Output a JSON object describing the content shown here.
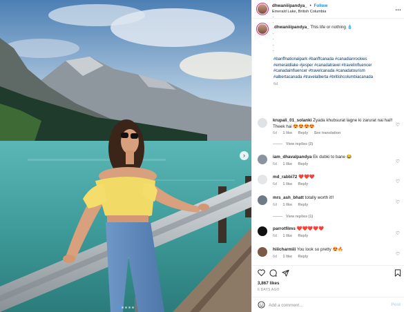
{
  "header": {
    "username": "dhwaniiipandya_",
    "separator": "•",
    "follow_label": "Follow",
    "location": "Emerald Lake, British Columbia",
    "more": "…"
  },
  "caption": {
    "username": "dhwaniiipandya_",
    "text": "This life or nothing 💧",
    "dot_lines": [
      ".",
      ".",
      ".",
      ".",
      ".",
      ".",
      ".",
      "."
    ],
    "hashtags": "#banffnationalpark #banffcanada #canadianrockies #emeraldlake #jesper #canadatravel #travelinfluencer #canadainfluencer #travelcanada #canadatourism #albertacanada #travelalberta #britishcolumbiacanada",
    "time": "6d"
  },
  "comments": [
    {
      "username": "krupali_01_solanki",
      "text": "Zyada khubsurat lagne ki zarurat nai hai!! Theek hai 😍😍😍😍",
      "time": "6d",
      "likes": "1 like",
      "reply": "Reply",
      "extra": "See translation",
      "replies_label": "View replies (2)"
    },
    {
      "username": "iam_dhavalpandya",
      "text": "Ek dubki to bane 😂",
      "time": "6d",
      "likes": "1 like",
      "reply": "Reply"
    },
    {
      "username": "md_rabbi72",
      "text": "❤️❤️❤️",
      "time": "6d",
      "likes": "1 like",
      "reply": "Reply"
    },
    {
      "username": "mrs_ash_bhatt",
      "text": "totally worth it!!",
      "time": "6d",
      "likes": "1 like",
      "reply": "Reply",
      "replies_label": "View replies (1)"
    },
    {
      "username": "parrotfilms",
      "text": "❤️❤️❤️❤️❤️",
      "time": "6d",
      "likes": "1 like",
      "reply": "Reply"
    },
    {
      "username": "hiiicharmiii",
      "text": "You look so pretty 😍🔥",
      "time": "6d",
      "likes": "1 like",
      "reply": "Reply"
    }
  ],
  "post": {
    "likes": "3,867 likes",
    "ago": "6 DAYS AGO"
  },
  "composer": {
    "placeholder": "Add a comment…",
    "post_label": "Post"
  },
  "icons": {
    "like": "heart-icon",
    "comment": "comment-icon",
    "share": "share-icon",
    "save": "bookmark-icon",
    "emoji": "emoji-icon",
    "next": "chevron-right-icon"
  },
  "colors": {
    "link": "#00376b",
    "follow": "#0095f6",
    "muted": "#8e8e8e"
  },
  "carousel": {
    "slides": 5,
    "active": 1,
    "next_glyph": "›"
  }
}
